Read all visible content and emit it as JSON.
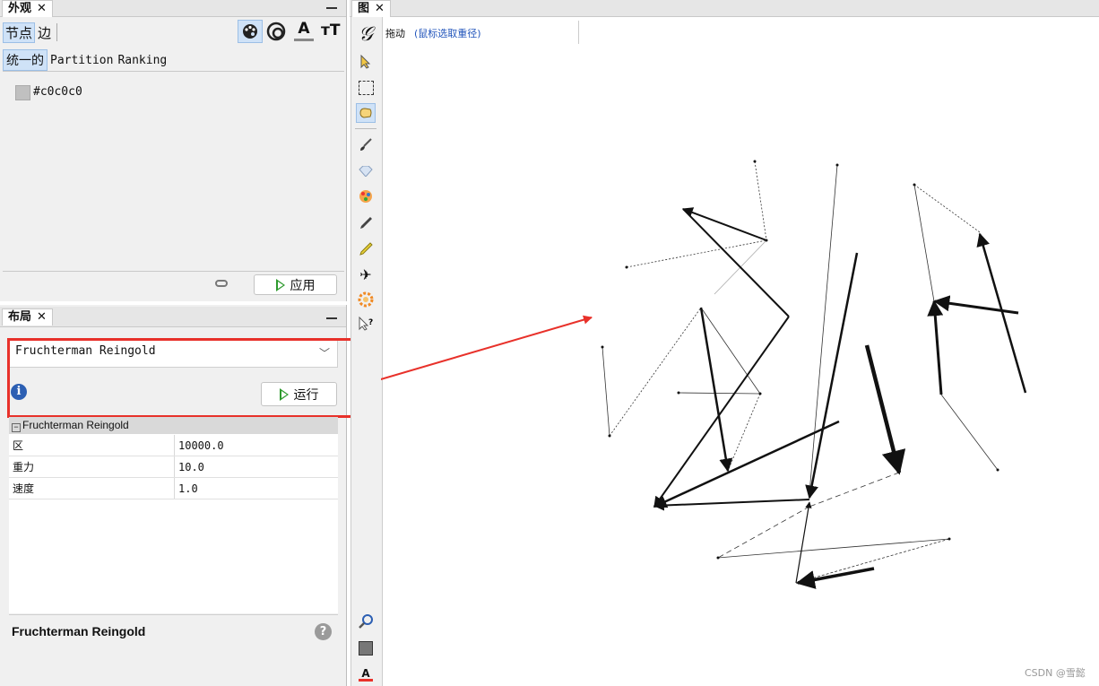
{
  "appearance": {
    "tab_title": "外观",
    "close": "✕",
    "subtabs": [
      "节点",
      "边"
    ],
    "mode_tabs": [
      "统一的",
      "Partition",
      "Ranking"
    ],
    "color_value": "#c0c0c0",
    "apply_label": "应用"
  },
  "layout": {
    "tab_title": "布局",
    "close": "✕",
    "algorithm_selected": "Fruchterman Reingold",
    "run_label": "运行",
    "section_title": "Fruchterman Reingold",
    "properties": [
      {
        "name": "区",
        "value": "10000.0"
      },
      {
        "name": "重力",
        "value": "10.0"
      },
      {
        "name": "速度",
        "value": "1.0"
      }
    ],
    "description_title": "Fruchterman Reingold"
  },
  "graph": {
    "tab_title": "图",
    "close": "✕",
    "toolbar_mode": "拖动",
    "toolbar_hint": "(鼠标选取重径)"
  },
  "watermark": "CSDN @雪懿",
  "colors": {
    "highlight": "#e8312a",
    "accent": "#2e9a2e",
    "selected_tab": "#cfe2f7"
  }
}
